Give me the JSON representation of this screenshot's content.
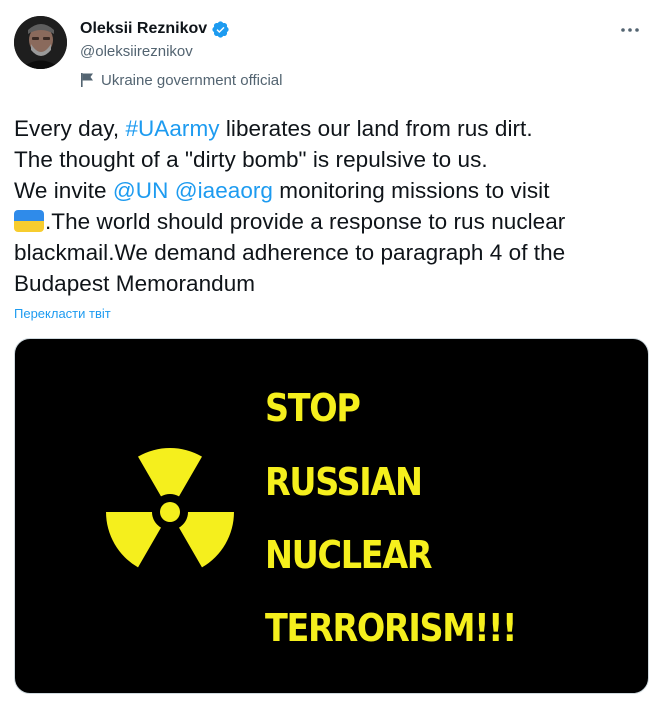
{
  "author": {
    "display_name": "Oleksii Reznikov",
    "handle": "@oleksiireznikov",
    "label": "Ukraine government official",
    "verified": true
  },
  "icons": {
    "verified": "verified-badge-icon",
    "label": "flag-icon",
    "more": "more-options-icon",
    "media": "radiation-hazard-icon"
  },
  "tweet": {
    "segments": [
      "Every day, ",
      "#UAarmy",
      " liberates our land from rus dirt.",
      "The thought of a \"dirty bomb\" is repulsive to us.",
      "We invite ",
      "@UN",
      " ",
      "@iaeaorg",
      " monitoring missions to visit",
      ".The world should provide a response to rus nuclear",
      "blackmail.We demand adherence to paragraph 4 of the",
      "Budapest Memorandum"
    ],
    "translate_label": "Перекласти твіт"
  },
  "media": {
    "lines": [
      "STOP",
      "RUSSIAN",
      "NUCLEAR",
      "TERRORISM!!!"
    ]
  },
  "colors": {
    "link": "#1d9bf0",
    "secondary_text": "#536471",
    "poster_yellow": "#f5ef1d",
    "flag_blue": "#2f8bea",
    "flag_yellow": "#f7cd2f"
  }
}
